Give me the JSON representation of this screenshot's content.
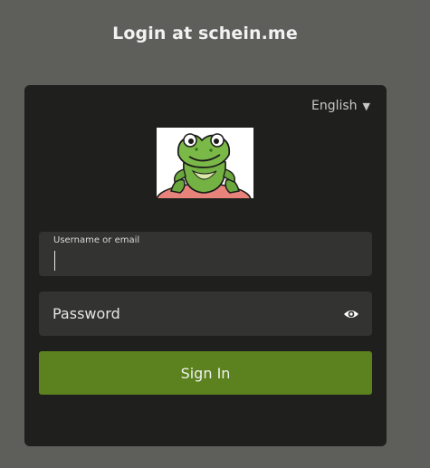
{
  "page": {
    "title": "Login at schein.me"
  },
  "language": {
    "selected": "English",
    "caret": "▼"
  },
  "logo": {
    "icon": "frog-logo"
  },
  "username": {
    "label": "Username or email",
    "value": ""
  },
  "password": {
    "placeholder": "Password",
    "value": "",
    "toggle_icon": "eye-icon"
  },
  "actions": {
    "signin_label": "Sign In"
  },
  "colors": {
    "background": "#5e5e5a",
    "card": "#1f1f1d",
    "field": "#333331",
    "primary": "#5b821e"
  }
}
